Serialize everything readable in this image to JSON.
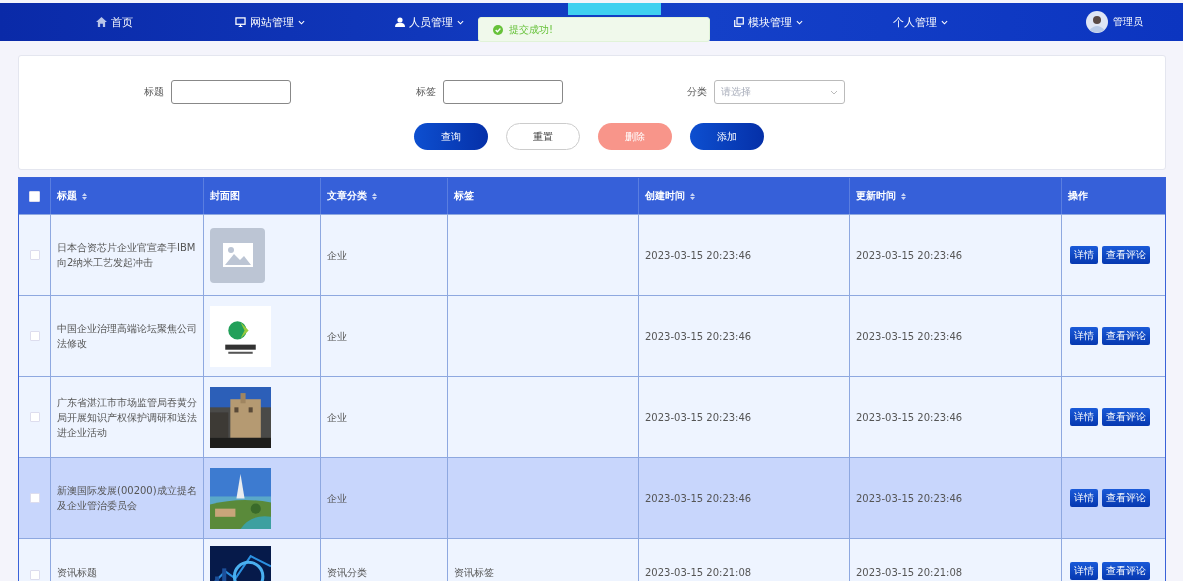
{
  "nav": {
    "items": [
      {
        "label": "首页",
        "dropdown": false
      },
      {
        "label": "网站管理",
        "dropdown": true
      },
      {
        "label": "人员管理",
        "dropdown": true
      },
      {
        "label": "模块管理",
        "dropdown": true
      },
      {
        "label": "个人管理",
        "dropdown": true
      }
    ],
    "user": {
      "name": "管理员"
    }
  },
  "toast": {
    "kind": "success",
    "message": "提交成功!"
  },
  "search": {
    "fields": [
      {
        "label": "标题",
        "kind": "input"
      },
      {
        "label": "标签",
        "kind": "input"
      },
      {
        "label": "分类",
        "kind": "select",
        "placeholder": "请选择"
      }
    ],
    "buttons": [
      {
        "label": "查询",
        "kind": "primary"
      },
      {
        "label": "重置",
        "kind": "plain"
      },
      {
        "label": "删除",
        "kind": "danger"
      },
      {
        "label": "添加",
        "kind": "primary"
      }
    ]
  },
  "table": {
    "all_checked": false,
    "columns": [
      {
        "label": "标题",
        "sortable": true
      },
      {
        "label": "封面图",
        "sortable": false
      },
      {
        "label": "文章分类",
        "sortable": true
      },
      {
        "label": "标签",
        "sortable": false
      },
      {
        "label": "创建时间",
        "sortable": true
      },
      {
        "label": "更新时间",
        "sortable": true
      },
      {
        "label": "操作",
        "sortable": false
      }
    ],
    "rows": [
      {
        "selected": false,
        "checked": false,
        "title": "日本合资芯片企业官宣牵手IBM 向2纳米工艺发起冲击",
        "cover": {
          "kind": "placeholder"
        },
        "category": "企业",
        "tag": "",
        "created": "2023-03-15 20:23:46",
        "updated": "2023-03-15 20:23:46",
        "actions": [
          "详情",
          "查看评论"
        ]
      },
      {
        "selected": false,
        "checked": false,
        "title": "中国企业治理高端论坛聚焦公司法修改",
        "cover": {
          "kind": "picture"
        },
        "category": "企业",
        "tag": "",
        "created": "2023-03-15 20:23:46",
        "updated": "2023-03-15 20:23:46",
        "actions": [
          "详情",
          "查看评论"
        ]
      },
      {
        "selected": false,
        "checked": false,
        "title": "广东省湛江市市场监管局吞黄分局开展知识产权保护调研和送法进企业活动",
        "cover": {
          "kind": "picture"
        },
        "category": "企业",
        "tag": "",
        "created": "2023-03-15 20:23:46",
        "updated": "2023-03-15 20:23:46",
        "actions": [
          "详情",
          "查看评论"
        ]
      },
      {
        "selected": true,
        "checked": false,
        "title": "新澳国际发展(00200)成立提名及企业管治委员会",
        "cover": {
          "kind": "picture"
        },
        "category": "企业",
        "tag": "",
        "created": "2023-03-15 20:23:46",
        "updated": "2023-03-15 20:23:46",
        "actions": [
          "详情",
          "查看评论"
        ]
      },
      {
        "selected": false,
        "checked": false,
        "title": "资讯标题",
        "cover": {
          "kind": "picture"
        },
        "category": "资讯分类",
        "tag": "资讯标签",
        "created": "2023-03-15 20:21:08",
        "updated": "2023-03-15 20:21:08",
        "actions": [
          "详情",
          "查看评论"
        ]
      }
    ]
  }
}
